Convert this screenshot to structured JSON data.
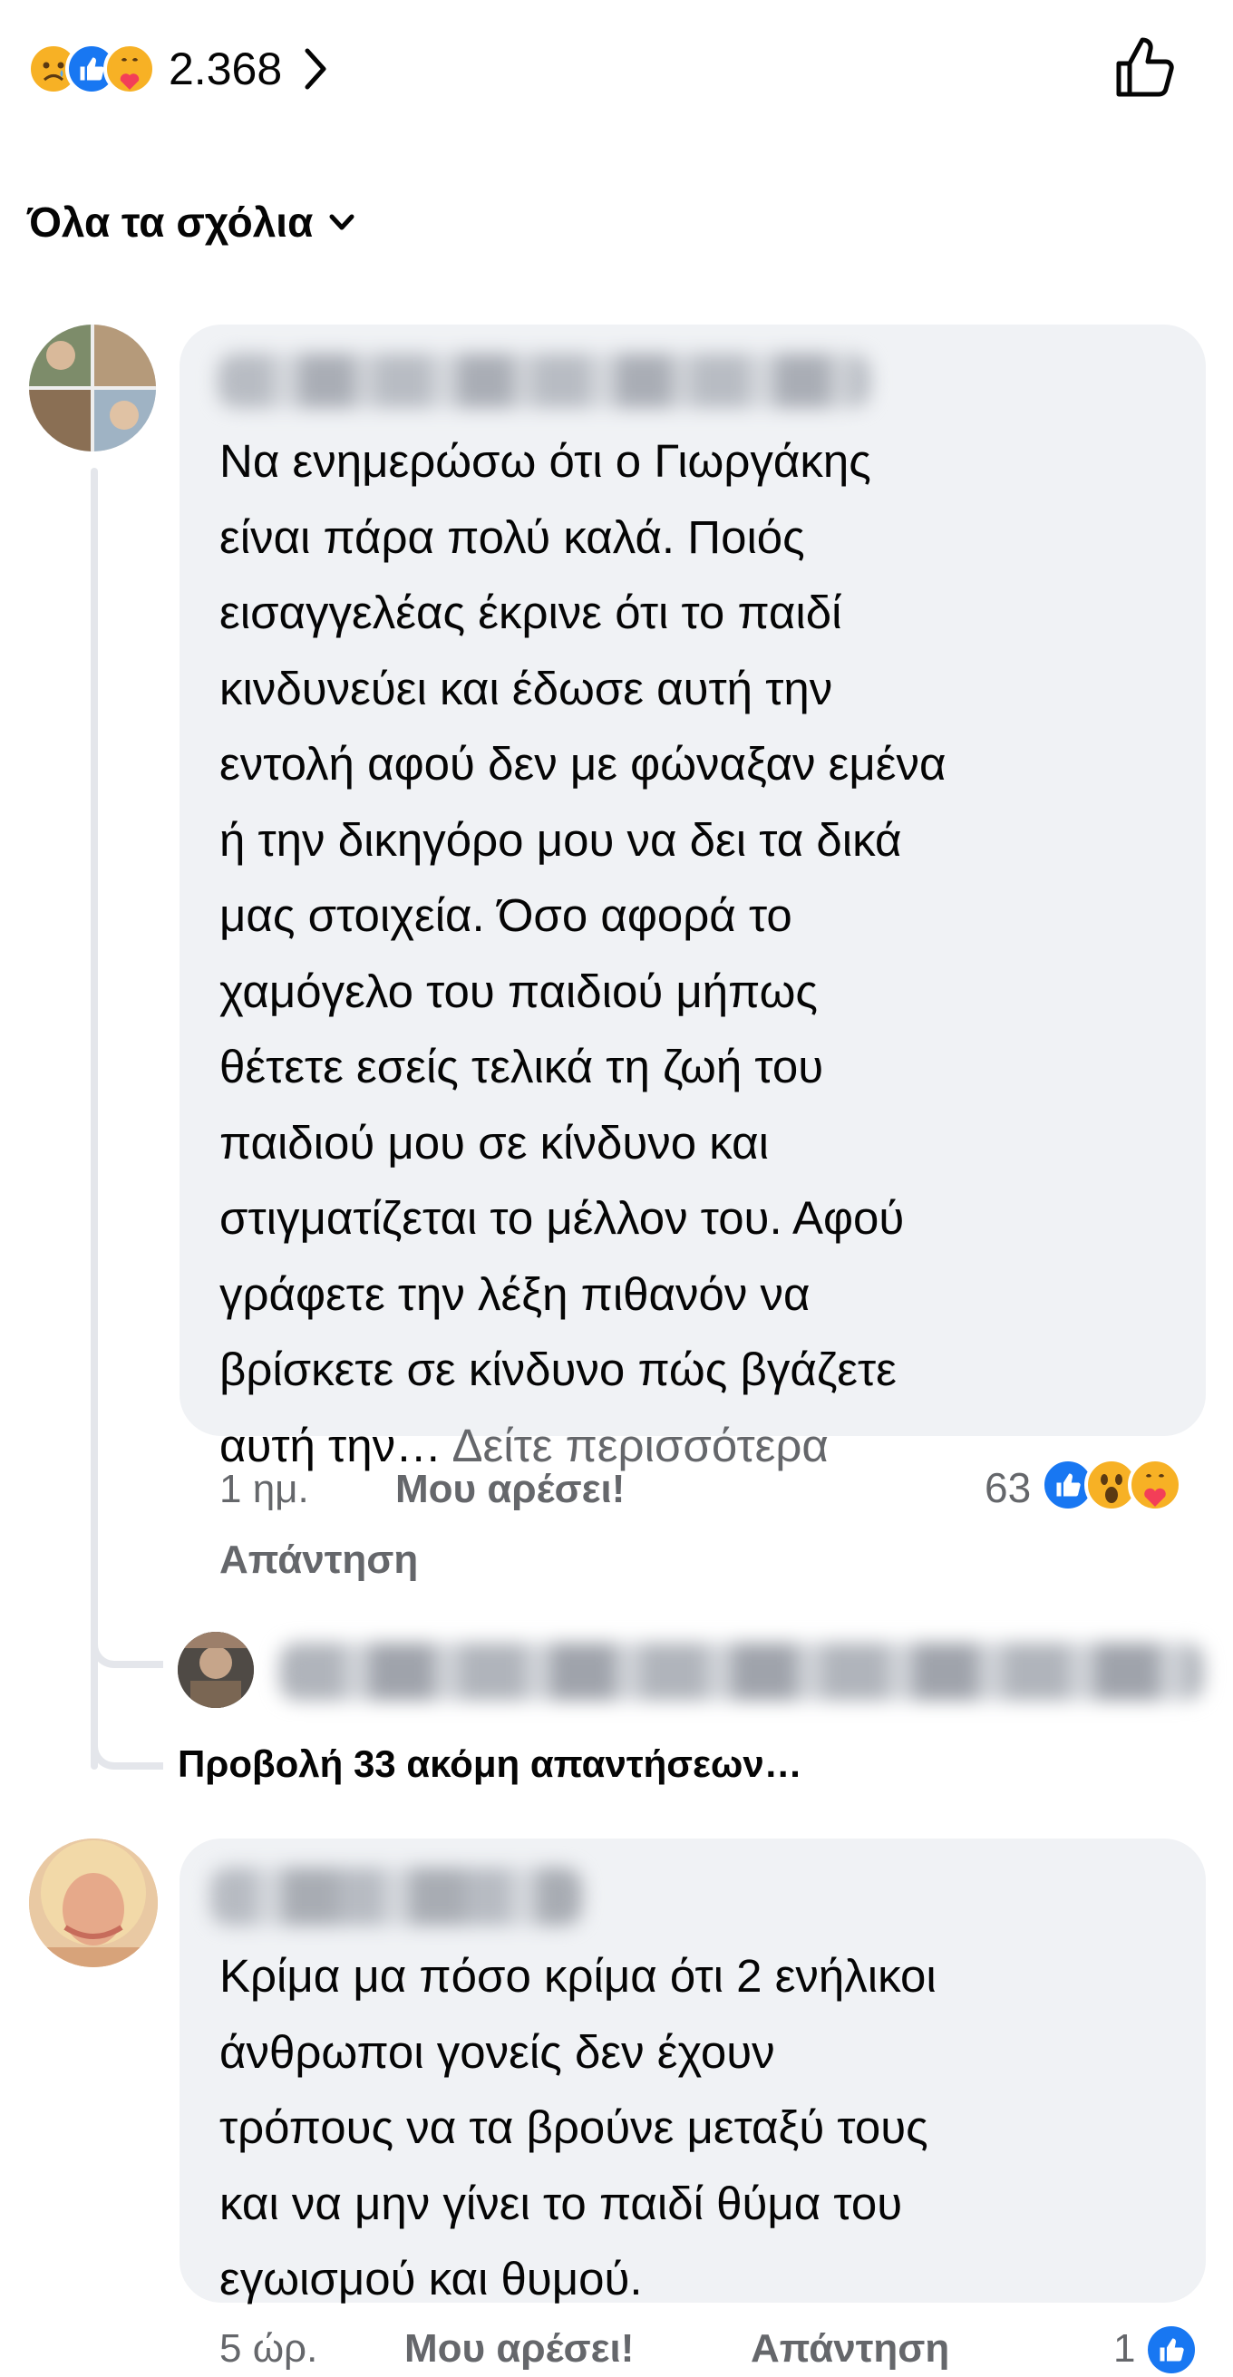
{
  "reactions_bar": {
    "icons": [
      "sad-reaction-icon",
      "like-reaction-icon",
      "care-reaction-icon"
    ],
    "total": "2.368"
  },
  "filter": {
    "label": "Όλα τα σχόλια"
  },
  "comments": [
    {
      "text": "Να ενημερώσω ότι ο Γιωργάκης\nείναι πάρα πολύ καλά. Ποιός\nεισαγγελέας έκρινε ότι το παιδί\nκινδυνεύει και έδωσε αυτή την\nεντολή αφού δεν με φώναξαν εμένα\nή την δικηγόρο μου να δει τα δικά\nμας στοιχεία. Όσο αφορά το\nχαμόγελο του παιδιού μήπως\nθέτετε εσείς τελικά τη ζωή του\nπαιδιού μου σε κίνδυνο και\nστιγματίζεται το μέλλον του. Αφού\nγράφετε την λέξη πιθανόν να\nβρίσκετε σε κίνδυνο πώς βγάζετε\nαυτή την…",
      "see_more": "Δείτε περισσότερα",
      "time": "1 ημ.",
      "like_label": "Μου αρέσει!",
      "reply_label": "Απάντηση",
      "reaction_count": "63",
      "reaction_icons": [
        "like-reaction-icon",
        "wow-reaction-icon",
        "care-reaction-icon"
      ],
      "view_more_replies": "Προβολή 33 ακόμη απαντήσεων…"
    },
    {
      "text": "Κρίμα μα πόσο κρίμα ότι 2 ενήλικοι\nάνθρωποι  γονείς  δεν έχουν\nτρόπους να τα βρούνε μεταξύ τους\nκαι να μην γίνει το παιδί  θύμα του\nεγωισμού και θυμού.",
      "time": "5 ώρ.",
      "like_label": "Μου αρέσει!",
      "reply_label": "Απάντηση",
      "reaction_count": "1"
    }
  ],
  "colors": {
    "like_blue": "#1877f2",
    "emoji_yellow": "#f7b125",
    "bubble_bg": "#f0f2f5",
    "meta_gray": "#65676b"
  }
}
